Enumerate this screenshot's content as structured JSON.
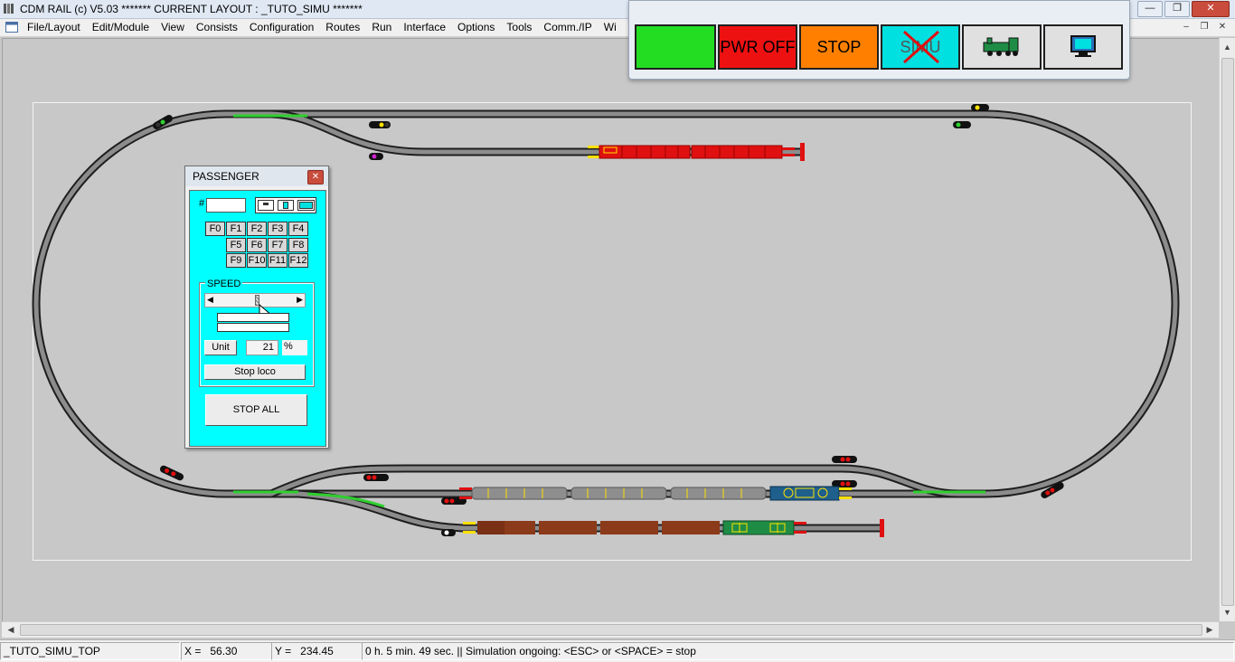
{
  "window": {
    "title": "CDM RAIL (c) V5.03     ******* CURRENT LAYOUT : _TUTO_SIMU *******",
    "buttons": {
      "minimize": "—",
      "restore": "❐",
      "close": "✕"
    }
  },
  "menu": {
    "items": [
      "File/Layout",
      "Edit/Module",
      "View",
      "Consists",
      "Configuration",
      "Routes",
      "Run",
      "Interface",
      "Options",
      "Tools",
      "Comm./IP",
      "Wi"
    ],
    "mdi_buttons": {
      "minimize": "–",
      "restore": "❐",
      "close": "✕"
    }
  },
  "toolbar": {
    "power_on_color": "#22dd22",
    "pwr_off_label": "PWR OFF",
    "pwr_off_color": "#ee1111",
    "stop_label": "STOP",
    "stop_color": "#ff8000",
    "simu_label": "SIMU",
    "simu_color": "#00e0e0",
    "loco_icon": "steam-locomotive-icon",
    "screen_icon": "monitor-icon"
  },
  "loco_panel": {
    "title": "PASSENGER",
    "address_prefix": "#",
    "function_keys": [
      "F0",
      "F1",
      "F2",
      "F3",
      "F4",
      "F5",
      "F6",
      "F7",
      "F8",
      "F9",
      "F10",
      "F11",
      "F12"
    ],
    "speed_label": "SPEED",
    "unit_button": "Unit",
    "speed_value": "21",
    "speed_unit": "%",
    "speed_percent": 21,
    "stop_loco_button": "Stop loco",
    "stop_all_button": "STOP ALL",
    "panel_color": "#00ffff"
  },
  "status": {
    "layout_name": "_TUTO_SIMU_TOP",
    "x_label": "X =",
    "x_value": "56.30",
    "y_label": "Y =",
    "y_value": "234.45",
    "message": "0 h. 5 min. 49 sec.  || Simulation ongoing: <ESC> or <SPACE> = stop"
  },
  "colors": {
    "background": "#c8c8c8",
    "track_rail": "#1e1e1e",
    "track_bed": "#8c8c8c",
    "occupied_block": "#2fcf2f",
    "passenger_train": "#e01010",
    "grey_coaches": "#8e8e8e",
    "freight_wagons": "#8b3a1a",
    "blue_loco": "#1f5f8c",
    "green_loco": "#1f8c45"
  }
}
